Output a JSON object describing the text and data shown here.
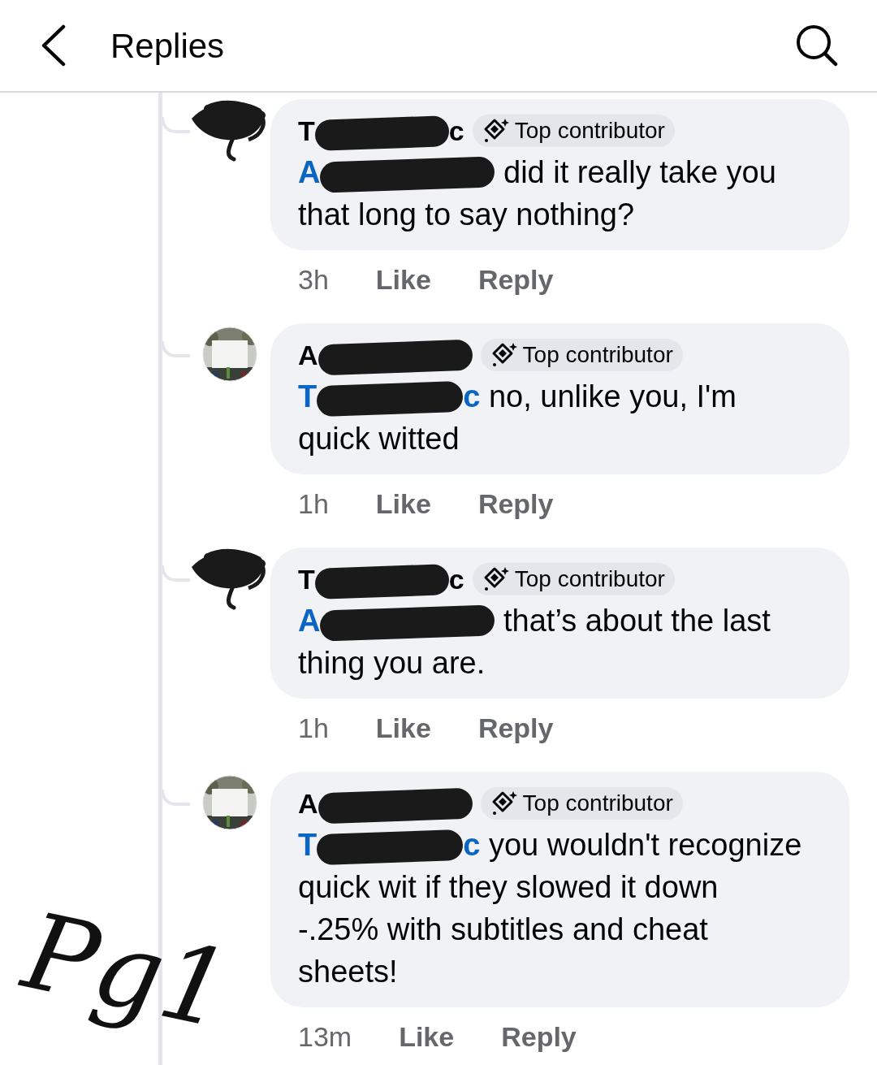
{
  "header": {
    "title": "Replies"
  },
  "comments": [
    {
      "kind": "scribble",
      "author_start": "T",
      "author_end": "c",
      "badge": "Top contributor",
      "mention_start": "A",
      "text": "did it really take you that long to say nothing?",
      "time": "3h",
      "like": "Like",
      "reply": "Reply"
    },
    {
      "kind": "picture",
      "author_start": "A",
      "badge": "Top contributor",
      "mention_start": "T",
      "mention_end": "c",
      "text": "no, unlike you, I'm quick witted",
      "time": "1h",
      "like": "Like",
      "reply": "Reply"
    },
    {
      "kind": "scribble",
      "author_start": "T",
      "author_end": "c",
      "badge": "Top contributor",
      "mention_start": "A",
      "text": "that’s about the last thing you are.",
      "time": "1h",
      "like": "Like",
      "reply": "Reply"
    },
    {
      "kind": "picture",
      "author_start": "A",
      "badge": "Top contributor",
      "mention_start": "T",
      "mention_end": "c",
      "text": "you wouldn't recognize quick wit if they slowed it down -.25% with subtitles and cheat sheets!",
      "time": "13m",
      "like": "Like",
      "reply": "Reply"
    }
  ],
  "annotation": "Pg1"
}
